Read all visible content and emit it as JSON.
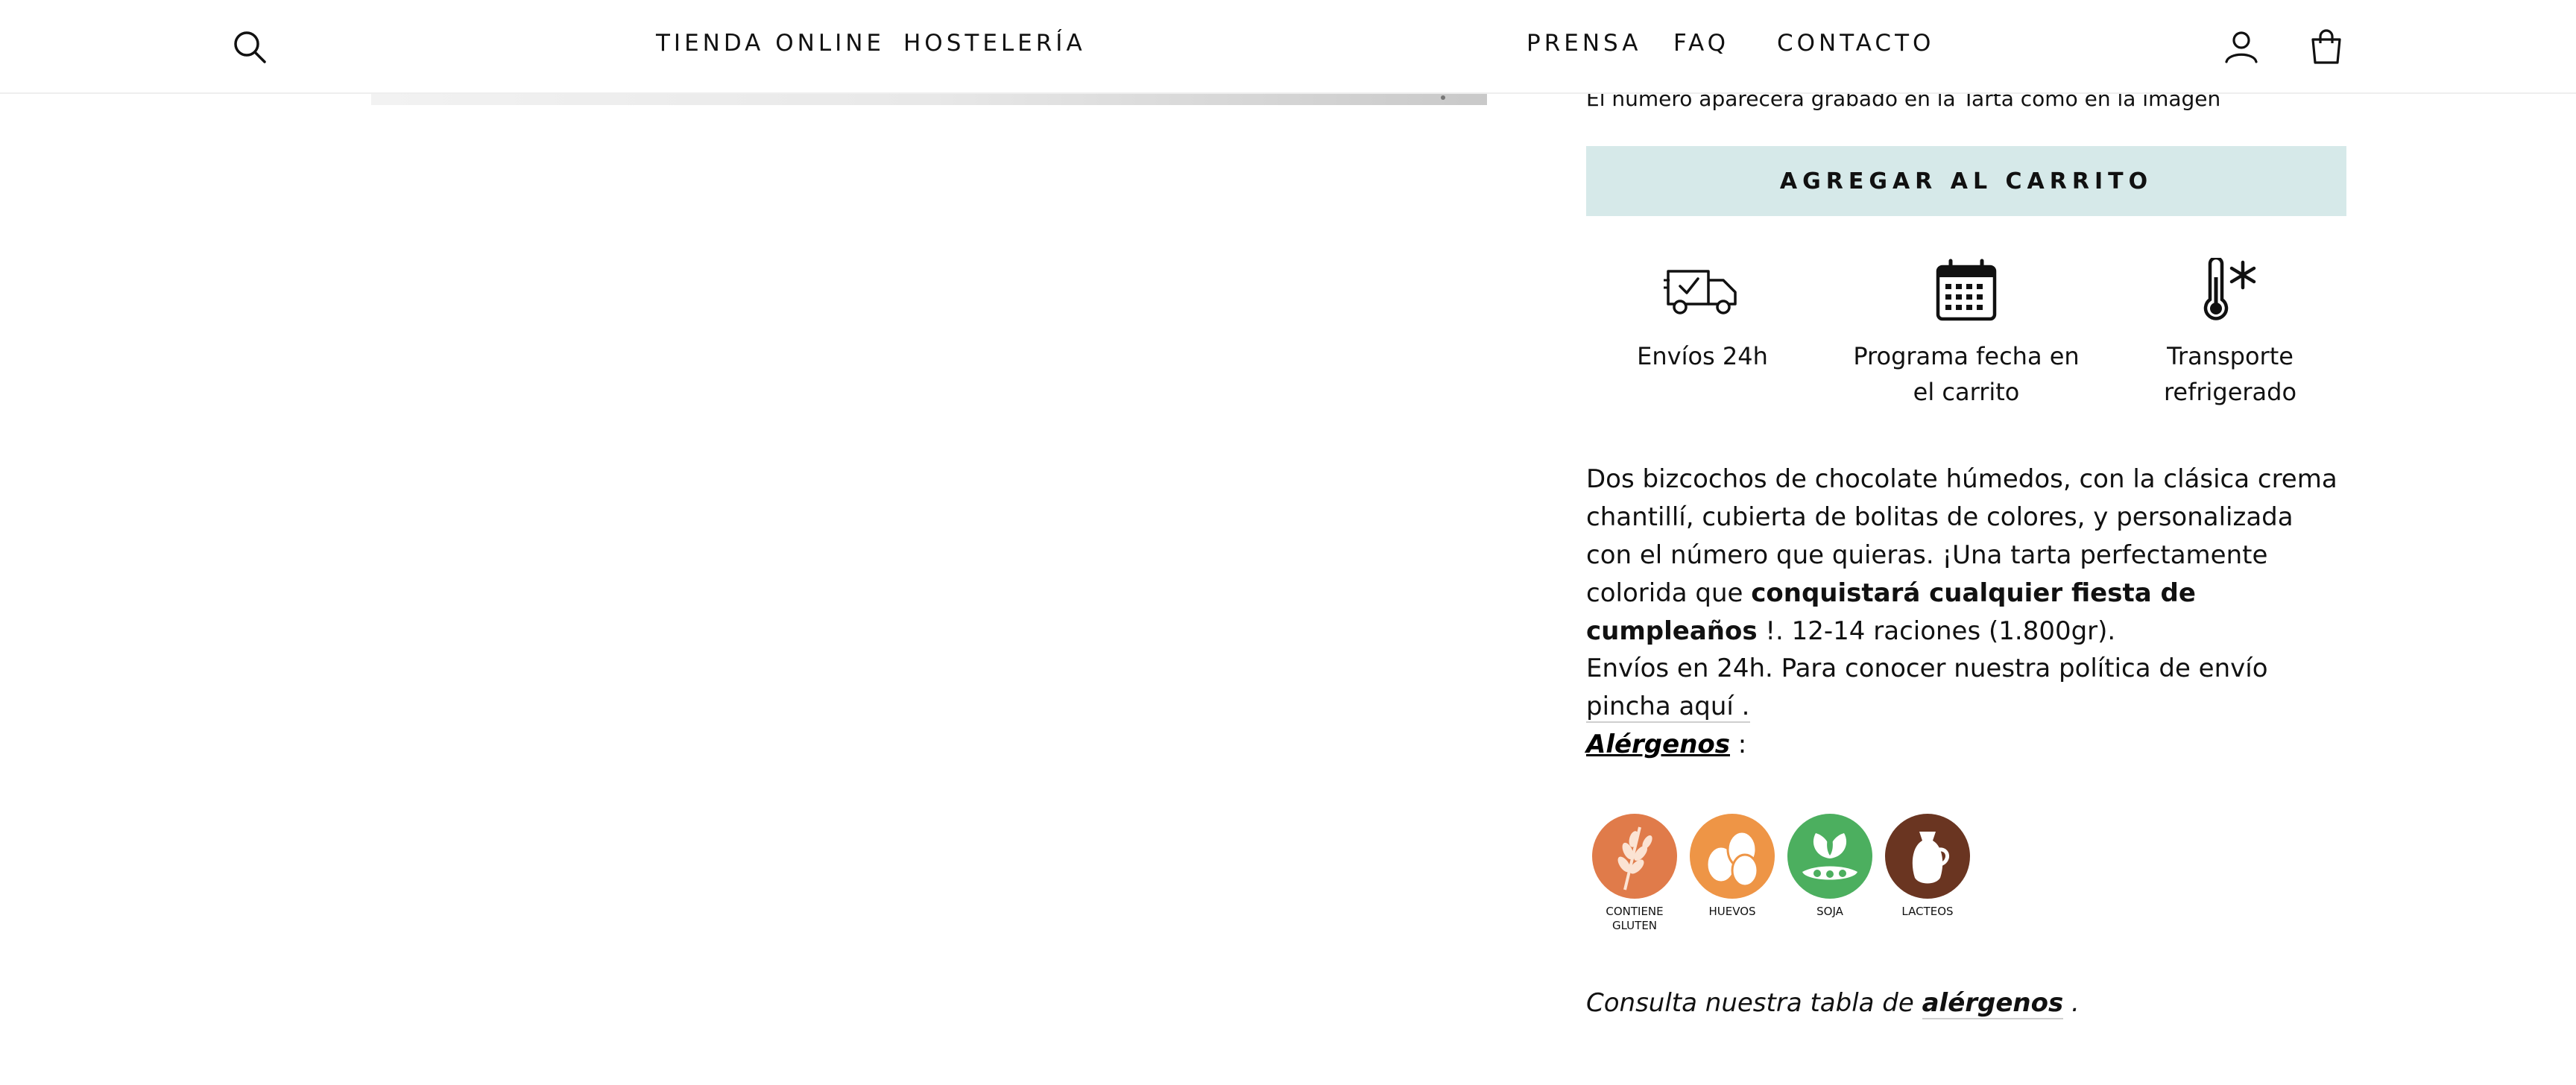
{
  "header": {
    "nav_left": [
      "TIENDA ONLINE",
      "HOSTELERÍA"
    ],
    "nav_right": [
      "PRENSA",
      "FAQ",
      "CONTACTO"
    ],
    "icons": [
      "search-icon",
      "account-icon",
      "cart-icon"
    ]
  },
  "product": {
    "engrave_note": "El numero aparecera grabado en la Tarta como en la imagen",
    "add_to_cart_label": "AGREGAR AL CARRITO",
    "features": [
      {
        "icon": "delivery-truck-icon",
        "label": "Envíos 24h"
      },
      {
        "icon": "calendar-icon",
        "label": "Programa fecha en el carrito"
      },
      {
        "icon": "thermometer-snowflake-icon",
        "label": "Transporte refrigerado"
      }
    ],
    "description": {
      "part1": "Dos bizcochos de chocolate húmedos, con la clásica crema chantillí, cubierta de bolitas de colores, y personalizada con el número que quieras. ¡Una tarta perfectamente colorida que ",
      "bold": "conquistará cualquier fiesta de cumpleaños",
      "part2": " !. 12-14 raciones (1.800gr)."
    },
    "shipping": {
      "text": "Envíos en 24h. Para conocer nuestra política de envío ",
      "link": "pincha aquí ."
    },
    "allergens": {
      "title": "Alérgenos",
      "suffix": " :",
      "items": [
        {
          "icon": "gluten-icon",
          "label": "CONTIENE GLUTEN",
          "color": "#e07b4a"
        },
        {
          "icon": "eggs-icon",
          "label": "HUEVOS",
          "color": "#ee9546"
        },
        {
          "icon": "soy-icon",
          "label": "SOJA",
          "color": "#4caf5f"
        },
        {
          "icon": "dairy-icon",
          "label": "LACTEOS",
          "color": "#6a3521"
        }
      ]
    },
    "consult": {
      "text": "Consulta nuestra tabla de ",
      "link": "alérgenos",
      "suffix": " ."
    }
  },
  "colors": {
    "button_bg": "#d6e9e9",
    "text": "#111111"
  }
}
